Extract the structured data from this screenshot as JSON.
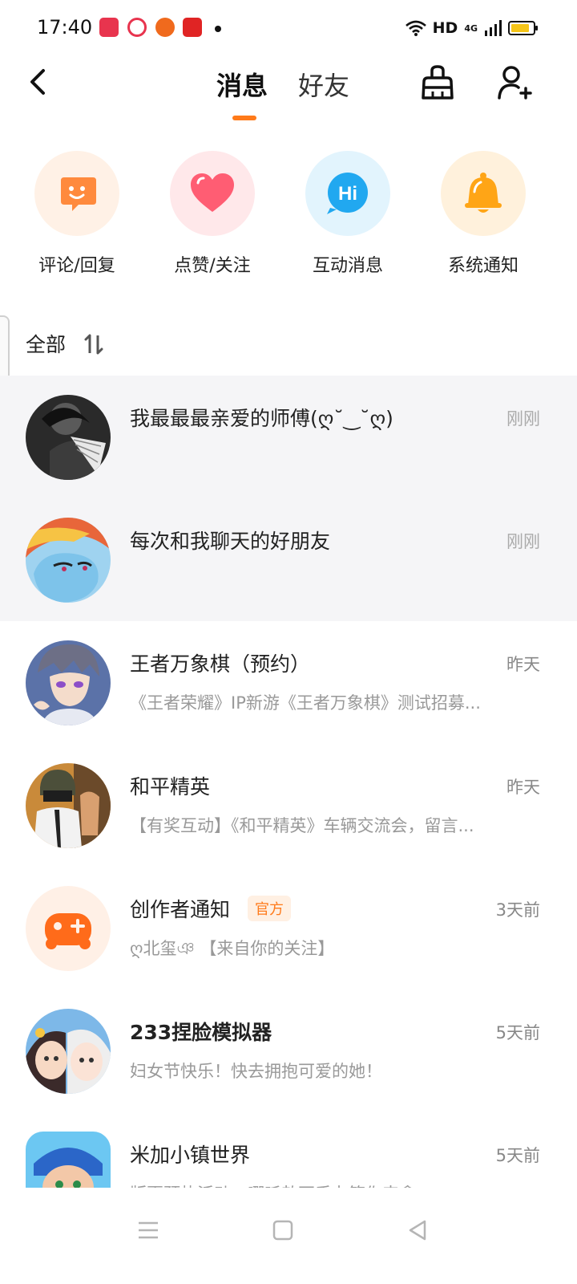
{
  "status_bar": {
    "time": "17:40",
    "network": "HD",
    "signal": "4G",
    "battery_level": 0.85
  },
  "header": {
    "tabs": [
      {
        "label": "消息",
        "active": true
      },
      {
        "label": "好友",
        "active": false
      }
    ],
    "icons": [
      "back-icon",
      "broom-icon",
      "add-friend-icon"
    ]
  },
  "quick_actions": [
    {
      "label": "评论/回复",
      "icon": "comment-icon",
      "color": "#ff8a3d"
    },
    {
      "label": "点赞/关注",
      "icon": "heart-icon",
      "color": "#ff5d73"
    },
    {
      "label": "互动消息",
      "icon": "hi-icon",
      "color": "#21a8f0"
    },
    {
      "label": "系统通知",
      "icon": "bell-icon",
      "color": "#ffa516"
    }
  ],
  "list_header": {
    "title": "全部",
    "sort_icon": "sort-icon"
  },
  "conversations": [
    {
      "title": "我最最最亲爱的师傅(ღ˘‿˘ღ)",
      "time": "刚刚",
      "preview": "",
      "pinned": true
    },
    {
      "title": "每次和我聊天的好朋友",
      "time": "刚刚",
      "preview": "",
      "pinned": true
    },
    {
      "title": "王者万象棋（预约）",
      "time": "昨天",
      "preview": "《王者荣耀》IP新游《王者万象棋》测试招募...",
      "pinned": false
    },
    {
      "title": "和平精英",
      "time": "昨天",
      "preview": "【有奖互动】《和平精英》车辆交流会，留言...",
      "pinned": false
    },
    {
      "title": "创作者通知",
      "badge": "官方",
      "time": "3天前",
      "preview": "ღ北玺ঞ 【来自你的关注】",
      "pinned": false
    },
    {
      "title": "233捏脸模拟器",
      "time": "5天前",
      "preview": "妇女节快乐！快去拥抱可爱的她！",
      "pinned": false
    },
    {
      "title": "米加小镇世界",
      "time": "5天前",
      "preview": "版更预热活动：哪吒敖丙手办等你来拿",
      "pinned": false
    }
  ],
  "colors": {
    "accent": "#ff7a1a",
    "pinned_bg": "#f5f5f7"
  }
}
